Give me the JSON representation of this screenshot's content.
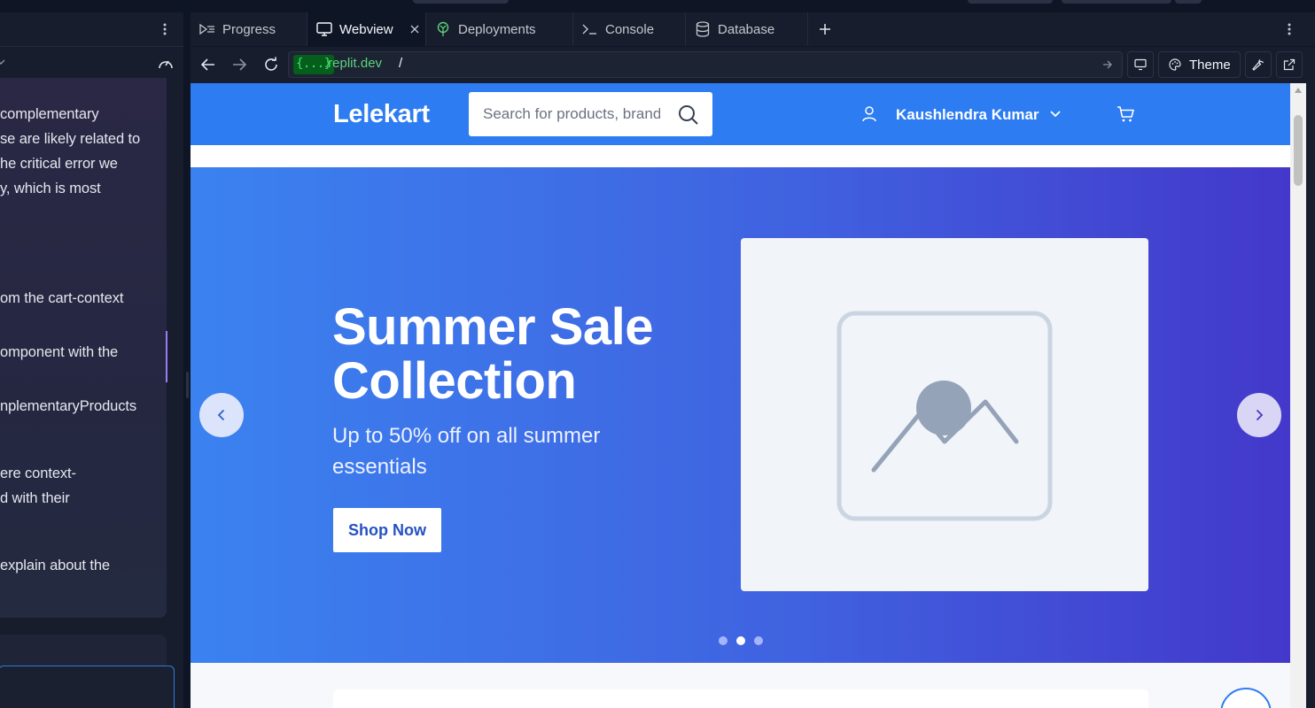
{
  "tabs": [
    {
      "label": "Progress",
      "icon": "progress-icon"
    },
    {
      "label": "Webview",
      "icon": "monitor-icon",
      "active": true
    },
    {
      "label": "Deployments",
      "icon": "deployments-icon"
    },
    {
      "label": "Console",
      "icon": "terminal-icon"
    },
    {
      "label": "Database",
      "icon": "database-icon"
    }
  ],
  "address": {
    "host_token": "{...}",
    "domain": ".replit.dev",
    "path": "/"
  },
  "toolbar": {
    "theme_label": "Theme"
  },
  "chat": {
    "lines": [
      "complementary",
      "se are likely related to",
      "he critical error we",
      "y, which is most",
      "om the cart-context",
      "omponent with the",
      "nplementaryProducts",
      "ere context-",
      "d with their",
      " explain about the"
    ]
  },
  "site": {
    "logo": "Lelekart",
    "search_placeholder": "Search for products, brands",
    "user_name": "Kaushlendra Kumar",
    "hero": {
      "title_line1": "Summer Sale",
      "title_line2": "Collection",
      "subtitle": "Up to 50% off on all summer essentials",
      "cta": "Shop Now",
      "active_slide": 2,
      "slide_count": 3
    }
  },
  "colors": {
    "brand": "#2d7cf2",
    "hero_start": "#3b82f0",
    "hero_end": "#4338ca",
    "ide_bg": "#0e1525",
    "accent_purple": "#9b7cf5"
  }
}
